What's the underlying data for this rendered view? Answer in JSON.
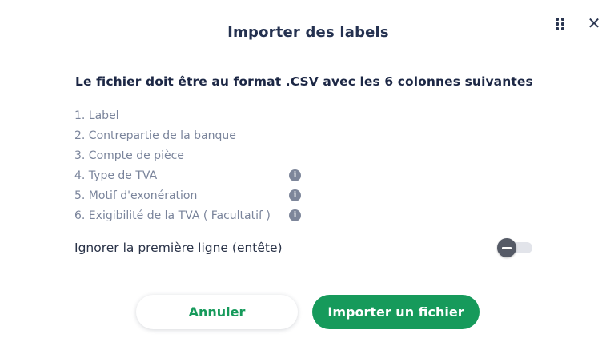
{
  "dialog": {
    "title": "Importer des labels",
    "drag_icon": "drag-handle-icon",
    "close_icon": "close-icon",
    "close_glyph": "✕"
  },
  "instructions": {
    "heading": "Le fichier doit être au format .CSV avec les 6 colonnes suivantes",
    "columns": [
      {
        "label": "1. Label",
        "info": false
      },
      {
        "label": "2. Contrepartie de la banque",
        "info": false
      },
      {
        "label": "3. Compte de pièce",
        "info": false
      },
      {
        "label": "4. Type de TVA",
        "info": true
      },
      {
        "label": "5. Motif d'exonération",
        "info": true
      },
      {
        "label": "6. Exigibilité de la TVA ( Facultatif )",
        "info": true
      }
    ],
    "info_glyph": "i"
  },
  "options": {
    "ignore_first_line_label": "Ignorer la première ligne (entête)",
    "ignore_first_line_enabled": false
  },
  "actions": {
    "cancel_label": "Annuler",
    "import_label": "Importer un fichier"
  },
  "colors": {
    "accent": "#169a5b",
    "title": "#243150",
    "muted_text": "#7a849b"
  }
}
